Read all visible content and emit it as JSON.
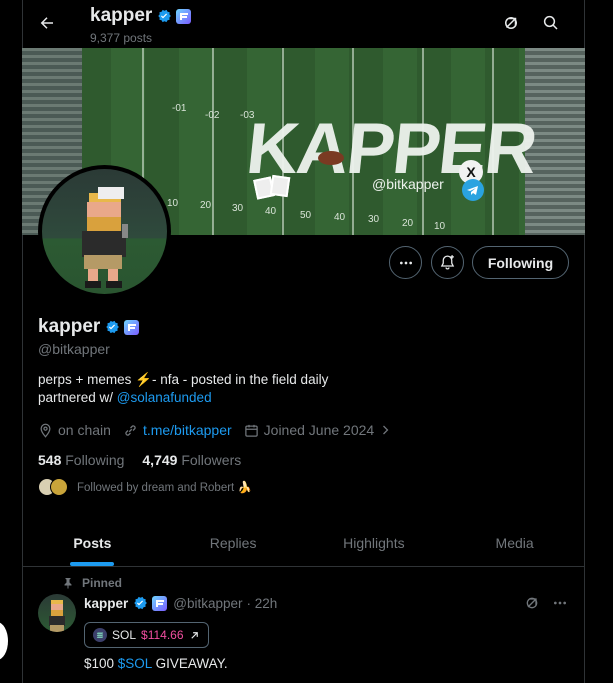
{
  "header": {
    "title": "kapper",
    "posts_count": "9,377 posts"
  },
  "banner": {
    "wordmark": "KAPPER",
    "handle_tag": "@bitkapper",
    "yard_numbers": [
      "-01",
      "-02",
      "-03",
      "10",
      "20",
      "30",
      "40",
      "50",
      "40",
      "30",
      "20",
      "10"
    ]
  },
  "profile": {
    "display_name": "kapper",
    "handle": "@bitkapper",
    "bio_line1": "perps + memes ⚡- nfa - posted in the field daily",
    "bio_line2_prefix": "partnered w/ ",
    "bio_line2_link": "@solanafunded",
    "location": "on chain",
    "website": "t.me/bitkapper",
    "joined": "Joined June 2024",
    "following_count": "548",
    "following_label": "Following",
    "followers_count": "4,749",
    "followers_label": "Followers",
    "followed_by": "Followed by dream and Robert 🍌"
  },
  "actions": {
    "following_button": "Following"
  },
  "tabs": [
    {
      "label": "Posts",
      "active": true
    },
    {
      "label": "Replies",
      "active": false
    },
    {
      "label": "Highlights",
      "active": false
    },
    {
      "label": "Media",
      "active": false
    }
  ],
  "post": {
    "pinned_label": "Pinned",
    "author_name": "kapper",
    "author_handle": "@bitkapper",
    "time": "· 22h",
    "chip_symbol": "SOL",
    "chip_price": "$114.66",
    "text_prefix": "$100 ",
    "text_cashtag": "$SOL",
    "text_suffix": " GIVEAWAY."
  },
  "colors": {
    "accent": "#1d9bf0",
    "background": "#000000",
    "muted_text": "#71767b",
    "price_pink": "#f24ea0"
  },
  "icons": [
    "back-arrow-icon",
    "grok-icon",
    "search-icon",
    "more-icon",
    "notify-bell-icon",
    "location-icon",
    "link-icon",
    "calendar-icon",
    "chevron-right-icon",
    "pin-icon",
    "verified-icon",
    "affiliate-badge-icon"
  ]
}
